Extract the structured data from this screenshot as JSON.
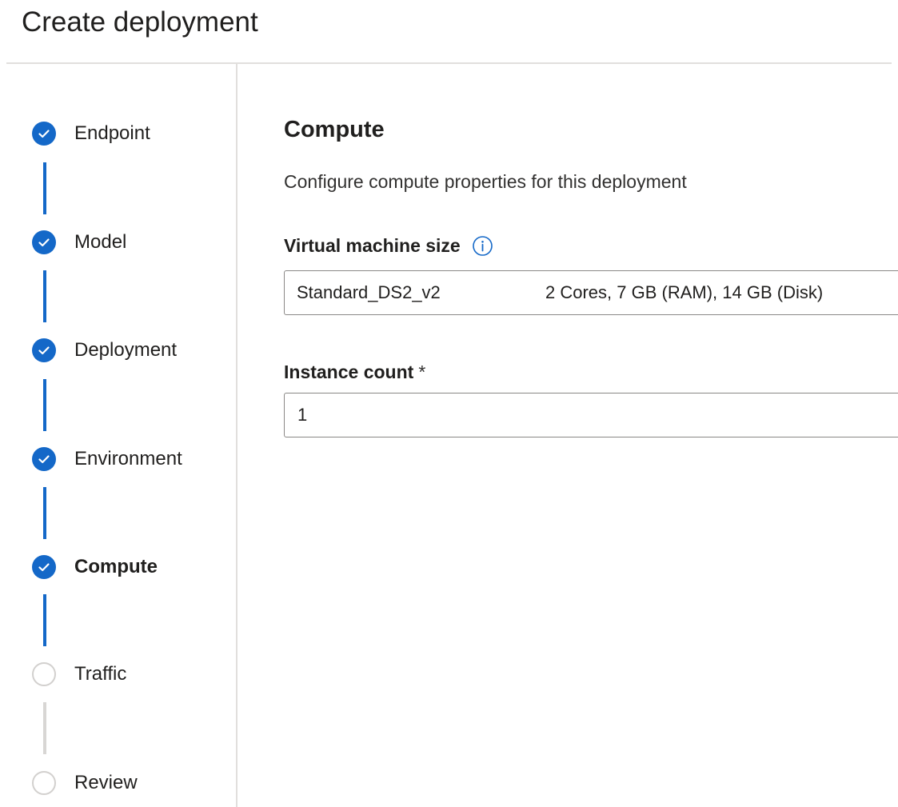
{
  "page": {
    "title": "Create deployment"
  },
  "stepper": {
    "steps": [
      {
        "label": "Endpoint",
        "status": "done"
      },
      {
        "label": "Model",
        "status": "done"
      },
      {
        "label": "Deployment",
        "status": "done"
      },
      {
        "label": "Environment",
        "status": "done"
      },
      {
        "label": "Compute",
        "status": "done",
        "active": true
      },
      {
        "label": "Traffic",
        "status": "pending"
      },
      {
        "label": "Review",
        "status": "pending"
      }
    ]
  },
  "compute": {
    "title": "Compute",
    "description": "Configure compute properties for this deployment",
    "vm_size": {
      "label": "Virtual machine size",
      "info_icon": "info-icon",
      "name": "Standard_DS2_v2",
      "specs": "2 Cores, 7 GB (RAM), 14 GB (Disk)"
    },
    "instance_count": {
      "label": "Instance count",
      "required_mark": "*",
      "value": "1"
    }
  },
  "colors": {
    "accent": "#1468c8",
    "pending_circle": "#d2d0ce",
    "divider": "#e1dfdd",
    "input_border": "#8a8886"
  }
}
